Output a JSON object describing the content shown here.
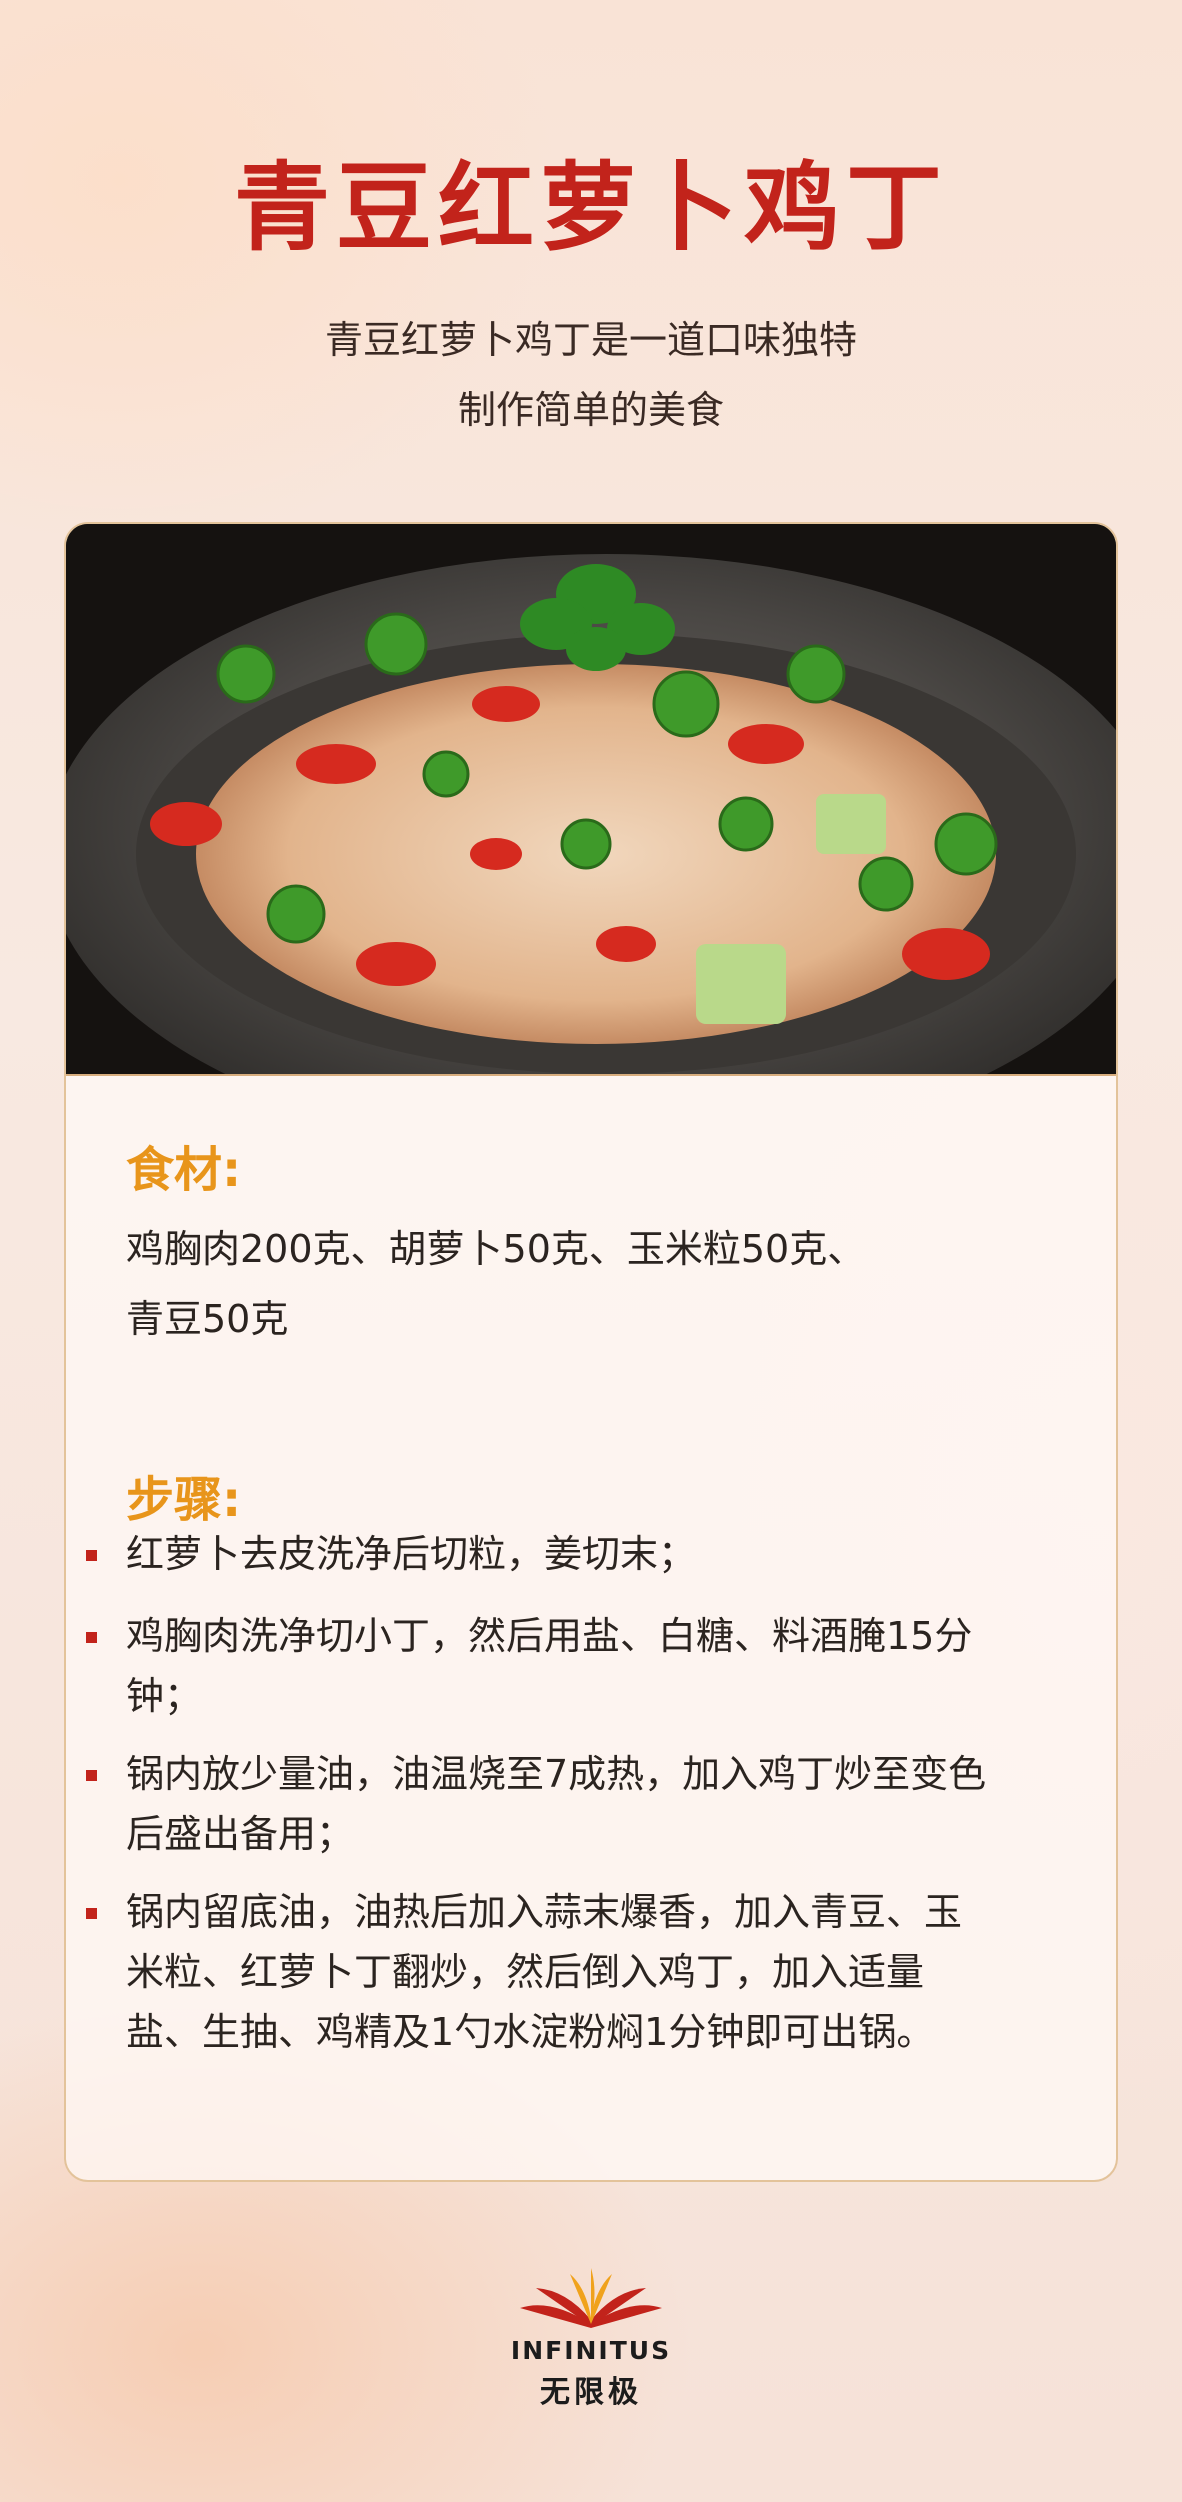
{
  "title": "青豆红萝卜鸡丁",
  "subtitle": {
    "line1": "青豆红萝卜鸡丁是一道口味独特",
    "line2": "制作简单的美食"
  },
  "ingredients": {
    "label": "食材:",
    "line1": "鸡胸肉200克、胡萝卜50克、玉米粒50克、",
    "line2": "青豆50克"
  },
  "steps": {
    "label": "步骤:",
    "items": [
      {
        "line1": "红萝卜去皮洗净后切粒，姜切末；"
      },
      {
        "line1": "鸡胸肉洗净切小丁，然后用盐、白糖、料酒腌15分",
        "line2": "钟；"
      },
      {
        "line1": "锅内放少量油，油温烧至7成热，加入鸡丁炒至变色",
        "line2": "后盛出备用；"
      },
      {
        "line1": "锅内留底油，油热后加入蒜末爆香，加入青豆、玉",
        "line2": "米粒、红萝卜丁翻炒，然后倒入鸡丁，加入适量",
        "line3": "盐、生抽、鸡精及1勺水淀粉焖1分钟即可出锅。"
      }
    ]
  },
  "logo": {
    "en": "INFINITUS",
    "cn": "无限极"
  },
  "colors": {
    "title": "#c2231b",
    "label": "#e8951b",
    "bullet": "#c2231b",
    "border": "#e3c39a"
  },
  "photo_icon": "dish-photo"
}
